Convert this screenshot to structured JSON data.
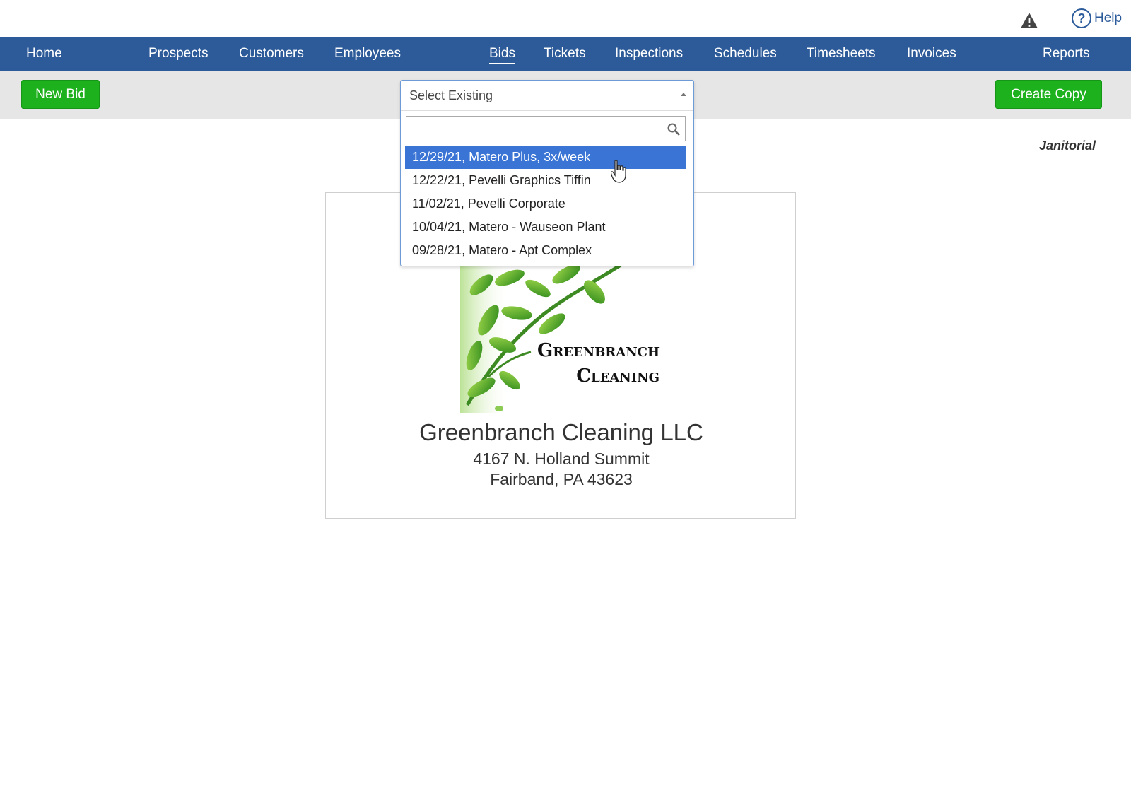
{
  "header": {
    "alert_icon": "warning-triangle-icon",
    "help_icon": "question-circle-icon",
    "help_label": "Help"
  },
  "nav": {
    "items": [
      {
        "label": "Home"
      },
      {
        "label": "Prospects"
      },
      {
        "label": "Customers"
      },
      {
        "label": "Employees"
      },
      {
        "label": "Bids",
        "active": true
      },
      {
        "label": "Tickets"
      },
      {
        "label": "Inspections"
      },
      {
        "label": "Schedules"
      },
      {
        "label": "Timesheets"
      },
      {
        "label": "Invoices"
      },
      {
        "label": "Reports"
      }
    ]
  },
  "toolbar": {
    "new_bid_label": "New Bid",
    "create_copy_label": "Create Copy"
  },
  "select_existing": {
    "value": "Select Existing",
    "search_value": "",
    "options": [
      {
        "label": "12/29/21, Matero Plus, 3x/week",
        "highlighted": true
      },
      {
        "label": "12/22/21, Pevelli Graphics Tiffin"
      },
      {
        "label": "11/02/21, Pevelli Corporate"
      },
      {
        "label": "10/04/21, Matero - Wauseon Plant"
      },
      {
        "label": "09/28/21, Matero - Apt Complex"
      }
    ]
  },
  "bid": {
    "category": "Janitorial",
    "logo_text_line1": "Greenbranch",
    "logo_text_line2": "Cleaning",
    "company_name": "Greenbranch Cleaning LLC",
    "address_line1": "4167 N. Holland Summit",
    "address_line2": "Fairband, PA 43623"
  },
  "colors": {
    "nav_bg": "#2d5b99",
    "button_green": "#1db11d",
    "highlight_blue": "#3a74d5"
  }
}
